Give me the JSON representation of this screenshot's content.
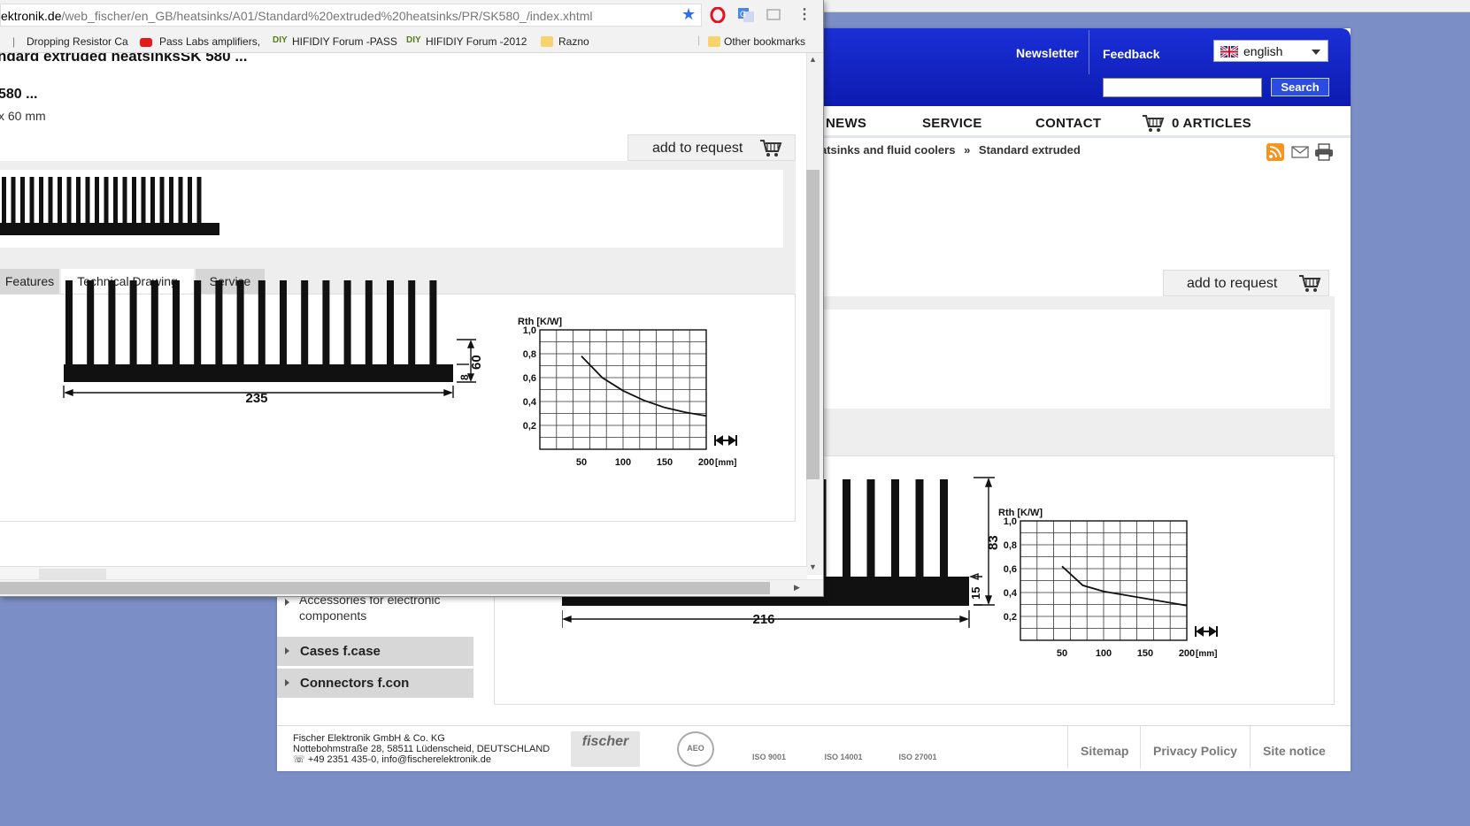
{
  "back": {
    "header": {
      "newsletter": "Newsletter",
      "feedback": "Feedback",
      "language": "english",
      "search_button": "Search"
    },
    "nav": {
      "latest_news": "ATEST NEWS",
      "service": "SERVICE",
      "contact": "CONTACT",
      "articles": "0 ARTICLES"
    },
    "breadcrumb": {
      "part1": "atsinks and fluid coolers",
      "sep": "»",
      "part2": "Standard extruded"
    },
    "add_to_request": "add to request",
    "drawing": {
      "width_label": "216",
      "height_label": "83",
      "base_label": "15"
    },
    "sidebar": {
      "accessories_line1": "Accessories for electronic",
      "accessories_line2": "components",
      "cases": "Cases f.case",
      "connectors": "Connectors f.con"
    },
    "footer": {
      "company": "Fischer Elektronik GmbH & Co. KG",
      "address": "Nottebohmstraße 28, 58511 Lüdenscheid, DEUTSCHLAND",
      "contact": "+49 2351 435-0, info@fischerelektronik.de",
      "cert1": "fischer",
      "cert2": "AEO",
      "cert3": "ISO 9001",
      "cert4": "ISO 14001",
      "cert5": "ISO 27001",
      "sitemap": "Sitemap",
      "privacy": "Privacy Policy",
      "notice": "Site notice"
    }
  },
  "front": {
    "url_domain": "ektronik.de",
    "url_path": "/web_fischer/en_GB/heatsinks/A01/Standard%20extruded%20heatsinks/PR/SK580_/index.xhtml",
    "bookmarks": [
      "Dropping Resistor Ca",
      "Pass Labs amplifiers,",
      "HIFIDIY Forum -PASS",
      "HIFIDIY Forum -2012",
      "Razno",
      "Other bookmarks"
    ],
    "title": "ndard extruded heatsinksSK 580 ...",
    "subtitle": "580 ...",
    "dimension": "x 60 mm",
    "add_to_request": "add to request",
    "tabs": {
      "features": "Features",
      "technical": "Technical Drawing",
      "service": "Service"
    },
    "drawing": {
      "width_label": "235",
      "height_label": "60",
      "base_label": "8"
    }
  },
  "chart_data": [
    {
      "type": "line",
      "title": "",
      "ylabel": "Rth [K/W]",
      "xlabel": "[mm]",
      "x_ticks": [
        "50",
        "100",
        "150",
        "200"
      ],
      "y_ticks": [
        "1,0",
        "0,8",
        "0,6",
        "0,4",
        "0,2"
      ],
      "xlim": [
        0,
        200
      ],
      "ylim": [
        0,
        1.0
      ],
      "grid": true,
      "x": [
        50,
        75,
        100,
        125,
        150,
        175,
        200
      ],
      "y": [
        0.78,
        0.6,
        0.49,
        0.41,
        0.35,
        0.31,
        0.28
      ]
    },
    {
      "type": "line",
      "title": "",
      "ylabel": "Rth [K/W]",
      "xlabel": "[mm]",
      "x_ticks": [
        "50",
        "100",
        "150",
        "200"
      ],
      "y_ticks": [
        "1,0",
        "0,8",
        "0,6",
        "0,4",
        "0,2"
      ],
      "xlim": [
        0,
        200
      ],
      "ylim": [
        0,
        1.0
      ],
      "grid": true,
      "x": [
        50,
        75,
        100,
        125,
        150,
        175,
        200
      ],
      "y": [
        0.62,
        0.46,
        0.41,
        0.38,
        0.35,
        0.32,
        0.29
      ]
    }
  ]
}
